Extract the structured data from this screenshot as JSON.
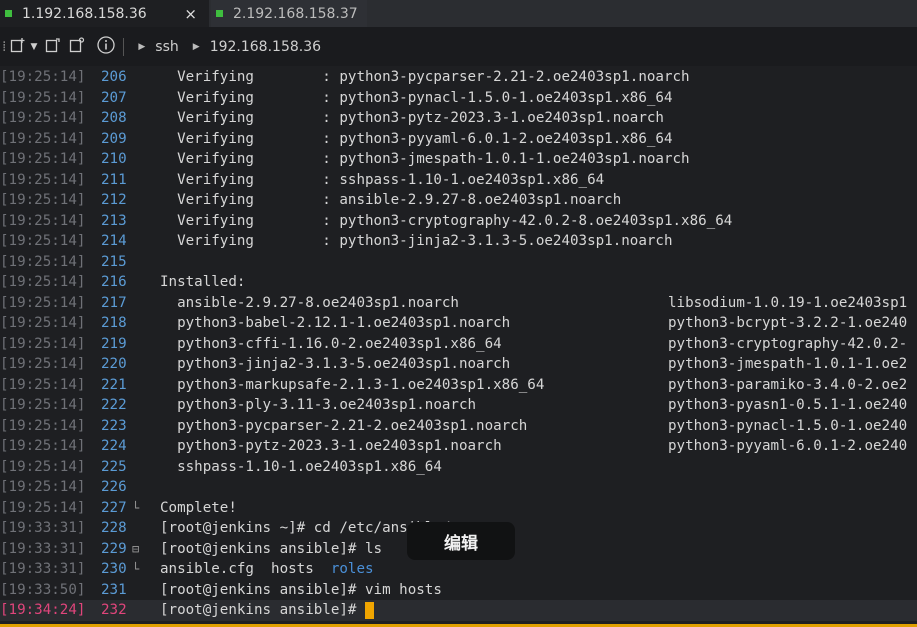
{
  "tabs": [
    {
      "label": "1.192.168.158.36",
      "active": true,
      "close": "×"
    },
    {
      "label": "2.192.168.158.37",
      "active": false
    }
  ],
  "toolbar": {
    "icons": [
      "new-tab-icon",
      "dropdown-icon",
      "split-icon",
      "new-window-icon",
      "info-icon"
    ],
    "breadcrumb": [
      "ssh",
      "192.168.158.36"
    ]
  },
  "tooltip": "编辑",
  "terminal": {
    "rows": [
      {
        "ts": "[19:25:14]",
        "ln": "206",
        "text": "  Verifying        : python3-pycparser-2.21-2.oe2403sp1.noarch"
      },
      {
        "ts": "[19:25:14]",
        "ln": "207",
        "text": "  Verifying        : python3-pynacl-1.5.0-1.oe2403sp1.x86_64"
      },
      {
        "ts": "[19:25:14]",
        "ln": "208",
        "text": "  Verifying        : python3-pytz-2023.3-1.oe2403sp1.noarch"
      },
      {
        "ts": "[19:25:14]",
        "ln": "209",
        "text": "  Verifying        : python3-pyyaml-6.0.1-2.oe2403sp1.x86_64"
      },
      {
        "ts": "[19:25:14]",
        "ln": "210",
        "text": "  Verifying        : python3-jmespath-1.0.1-1.oe2403sp1.noarch"
      },
      {
        "ts": "[19:25:14]",
        "ln": "211",
        "text": "  Verifying        : sshpass-1.10-1.oe2403sp1.x86_64"
      },
      {
        "ts": "[19:25:14]",
        "ln": "212",
        "text": "  Verifying        : ansible-2.9.27-8.oe2403sp1.noarch"
      },
      {
        "ts": "[19:25:14]",
        "ln": "213",
        "text": "  Verifying        : python3-cryptography-42.0.2-8.oe2403sp1.x86_64"
      },
      {
        "ts": "[19:25:14]",
        "ln": "214",
        "text": "  Verifying        : python3-jinja2-3.1.3-5.oe2403sp1.noarch"
      },
      {
        "ts": "[19:25:14]",
        "ln": "215",
        "text": ""
      },
      {
        "ts": "[19:25:14]",
        "ln": "216",
        "text": "Installed:"
      },
      {
        "ts": "[19:25:14]",
        "ln": "217",
        "text": "  ansible-2.9.27-8.oe2403sp1.noarch",
        "col2": "libsodium-1.0.19-1.oe2403sp1"
      },
      {
        "ts": "[19:25:14]",
        "ln": "218",
        "text": "  python3-babel-2.12.1-1.oe2403sp1.noarch",
        "col2": "python3-bcrypt-3.2.2-1.oe240"
      },
      {
        "ts": "[19:25:14]",
        "ln": "219",
        "text": "  python3-cffi-1.16.0-2.oe2403sp1.x86_64",
        "col2": "python3-cryptography-42.0.2-"
      },
      {
        "ts": "[19:25:14]",
        "ln": "220",
        "text": "  python3-jinja2-3.1.3-5.oe2403sp1.noarch",
        "col2": "python3-jmespath-1.0.1-1.oe2"
      },
      {
        "ts": "[19:25:14]",
        "ln": "221",
        "text": "  python3-markupsafe-2.1.3-1.oe2403sp1.x86_64",
        "col2": "python3-paramiko-3.4.0-2.oe2"
      },
      {
        "ts": "[19:25:14]",
        "ln": "222",
        "text": "  python3-ply-3.11-3.oe2403sp1.noarch",
        "col2": "python3-pyasn1-0.5.1-1.oe240"
      },
      {
        "ts": "[19:25:14]",
        "ln": "223",
        "text": "  python3-pycparser-2.21-2.oe2403sp1.noarch",
        "col2": "python3-pynacl-1.5.0-1.oe240"
      },
      {
        "ts": "[19:25:14]",
        "ln": "224",
        "text": "  python3-pytz-2023.3-1.oe2403sp1.noarch",
        "col2": "python3-pyyaml-6.0.1-2.oe240"
      },
      {
        "ts": "[19:25:14]",
        "ln": "225",
        "text": "  sshpass-1.10-1.oe2403sp1.x86_64"
      },
      {
        "ts": "[19:25:14]",
        "ln": "226",
        "text": ""
      },
      {
        "ts": "[19:25:14]",
        "ln": "227",
        "gutter": "└",
        "text": "Complete!"
      },
      {
        "ts": "[19:33:31]",
        "ln": "228",
        "text": "[root@jenkins ~]# cd /etc/ansible/"
      },
      {
        "ts": "[19:33:31]",
        "ln": "229",
        "gutter": "⊟",
        "text": "[root@jenkins ansible]# ls"
      },
      {
        "ts": "[19:33:31]",
        "ln": "230",
        "gutter": "└",
        "text": "ansible.cfg  hosts  ",
        "dir": "roles"
      },
      {
        "ts": "[19:33:50]",
        "ln": "231",
        "text": "[root@jenkins ansible]# vim hosts"
      },
      {
        "ts": "[19:34:24]",
        "ln": "232",
        "text": "[root@jenkins ansible]# ",
        "cursor": true,
        "active": true
      }
    ]
  },
  "colors": {
    "line_numbers": "#5b9bd5",
    "active_line": "#e0457b",
    "cursor": "#f0a500",
    "tab_dot": "#3fbe3f"
  }
}
